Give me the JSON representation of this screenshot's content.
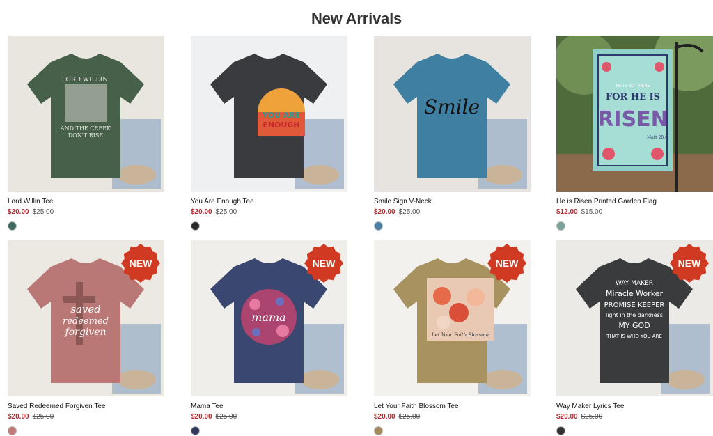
{
  "section_title": "New Arrivals",
  "products": [
    {
      "name": "Lord Willin Tee",
      "sale_price": "$20.00",
      "original_price": "$25.00",
      "swatch": "#3f6b62",
      "shirt_color": "#46604a",
      "bg": "#e9e6e0",
      "badge": "",
      "art_lines": [
        "LORD WILLIN'",
        "AND THE CREEK",
        "DON'T RISE"
      ]
    },
    {
      "name": "You Are Enough Tee",
      "sale_price": "$20.00",
      "original_price": "$25.00",
      "swatch": "#2b2b2b",
      "shirt_color": "#3a3b3f",
      "bg": "#eef0f2",
      "badge": "",
      "art_lines": [
        "YOU ARE",
        "ENOUGH"
      ]
    },
    {
      "name": "Smile Sign V-Neck",
      "sale_price": "$20.00",
      "original_price": "$25.00",
      "swatch": "#4b7ea5",
      "shirt_color": "#3f7fa2",
      "bg": "#e7e4df",
      "badge": "",
      "art_lines": [
        "Smile"
      ]
    },
    {
      "name": "He is Risen Printed Garden Flag",
      "sale_price": "$12.00",
      "original_price": "$15.00",
      "swatch": "#7aa19a",
      "shirt_color": "#8fd0c8",
      "bg": "#5e7b4a",
      "badge": "",
      "art_lines": [
        "HE IS NOT HERE",
        "FOR HE IS",
        "RISEN",
        "Matt 28:6"
      ]
    },
    {
      "name": "Saved Redeemed Forgiven Tee",
      "sale_price": "$20.00",
      "original_price": "$25.00",
      "swatch": "#c07a78",
      "shirt_color": "#b97876",
      "bg": "#ece8e2",
      "badge": "NEW",
      "art_lines": [
        "saved",
        "redeemed",
        "forgiven"
      ]
    },
    {
      "name": "Mama Tee",
      "sale_price": "$20.00",
      "original_price": "$25.00",
      "swatch": "#2f3a5c",
      "shirt_color": "#3a4770",
      "bg": "#efeeea",
      "badge": "NEW",
      "art_lines": [
        "mama"
      ]
    },
    {
      "name": "Let Your Faith Blossom Tee",
      "sale_price": "$20.00",
      "original_price": "$25.00",
      "swatch": "#a38a5e",
      "shirt_color": "#a8925f",
      "bg": "#f2f1ee",
      "badge": "NEW",
      "art_lines": [
        "Let Your Faith Blossom"
      ]
    },
    {
      "name": "Way Maker Lyrics Tee",
      "sale_price": "$20.00",
      "original_price": "$25.00",
      "swatch": "#333333",
      "shirt_color": "#3a3b3d",
      "bg": "#eceae6",
      "badge": "NEW",
      "art_lines": [
        "WAY MAKER",
        "Miracle Worker",
        "PROMISE KEEPER",
        "light in the darkness",
        "MY GOD",
        "THAT IS WHO YOU ARE"
      ]
    }
  ],
  "colors": {
    "sale": "#b5292e",
    "badge": "#d13a22"
  }
}
